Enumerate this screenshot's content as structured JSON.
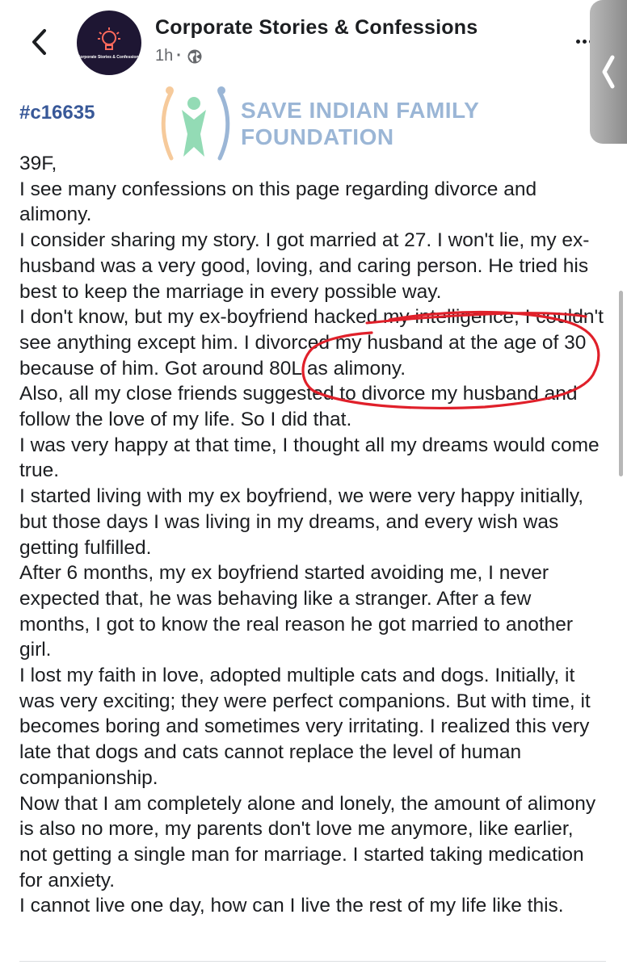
{
  "header": {
    "page_name": "Corporate Stories & Confessions",
    "avatar_text": "Corporate Stories & Confessions",
    "post_time": "1h",
    "audience_icon": "globe-icon",
    "back_icon": "chevron-left-icon",
    "more_icon": "more-dots-icon",
    "side_handle_icon": "chevron-left-icon"
  },
  "post": {
    "hashtag": "#c16635",
    "watermark": {
      "line1": "SAVE INDIAN FAMILY",
      "line2": "FOUNDATION"
    },
    "paragraphs": [
      "39F,",
      "I see many confessions on this page regarding divorce and alimony.",
      "I consider sharing my story. I got married at 27. I won't lie, my ex-husband was a very good, loving, and caring person. He tried his best to keep the marriage in every possible way.",
      "I don't know, but my ex-boyfriend hacked my intelligence, I couldn't see anything except him. I divorced my husband at the age of 30 because of him. Got around 80L as alimony.",
      "Also, all my close friends suggested to divorce my husband and follow the love of my life. So I did that.",
      "I was very happy at that time, I thought all my dreams would come true.",
      "I started living with my ex boyfriend, we were very happy initially, but those days I was living in my dreams, and every wish was getting fulfilled.",
      "After 6 months, my ex boyfriend started avoiding me, I never expected that, he was behaving like a stranger. After a few months, I got to know the real reason he got married to another girl.",
      "I lost my faith in love, adopted multiple cats and dogs. Initially, it was very exciting; they were perfect companions. But with time, it becomes boring and sometimes very irritating. I realized this very late that dogs and cats cannot replace the level of human companionship.",
      "Now that I am completely alone and lonely, the amount of alimony is also no more, my parents don't love me anymore, like earlier, not getting a single man for marriage. I started taking medication for anxiety.",
      "I cannot live one day, how can I live the rest of my life like this."
    ]
  },
  "colors": {
    "accent_link": "#385898",
    "annotation_red": "#e0202a",
    "text_primary": "#1c1e21",
    "text_secondary": "#65676b"
  }
}
